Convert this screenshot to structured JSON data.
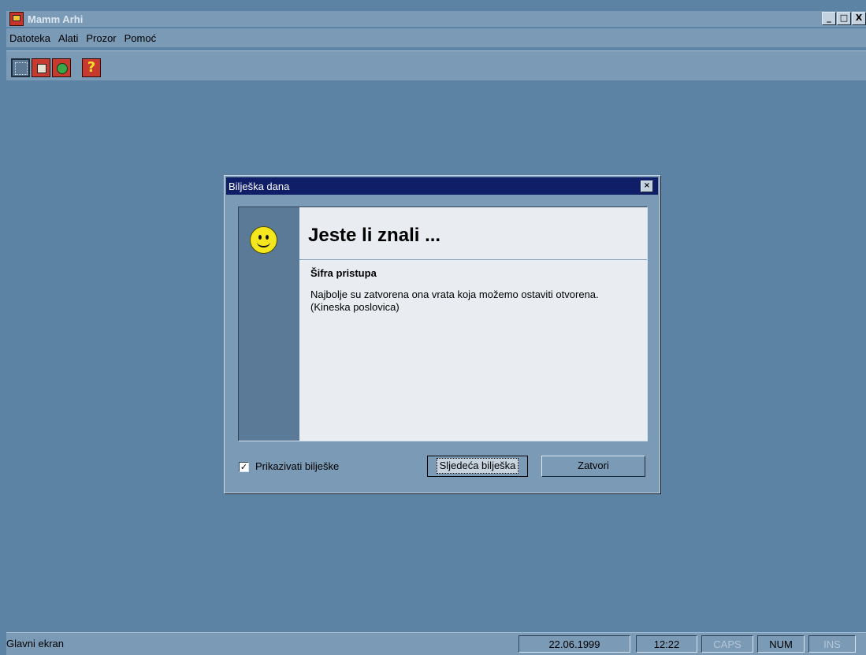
{
  "app": {
    "title": "Mamm Arhi",
    "icon": "app-icon",
    "window_controls": {
      "minimize": "_",
      "maximize": "□",
      "close": "X"
    }
  },
  "menu": {
    "items": [
      {
        "label": "Datoteka",
        "access_key": "D"
      },
      {
        "label": "Alati",
        "access_key": "A"
      },
      {
        "label": "Prozor",
        "access_key": "z"
      },
      {
        "label": "Pomoć",
        "access_key": "P"
      }
    ]
  },
  "toolbar": {
    "buttons": [
      {
        "icon": "select-frame-icon",
        "pressed": true
      },
      {
        "icon": "document-icon"
      },
      {
        "icon": "globe-icon"
      },
      {
        "icon": "help-icon",
        "glyph": "?"
      }
    ]
  },
  "dialog": {
    "title": "Bilješka dana",
    "close_glyph": "×",
    "heading": "Jeste li znali ...",
    "tip_title": "Šifra pristupa",
    "tip_text": "Najbolje su zatvorena ona vrata koja možemo ostaviti otvorena. (Kineska poslovica)",
    "icon": "smiley-icon",
    "show_checkbox": {
      "label": "Prikazivati bilješke",
      "checked": true,
      "mark": "✓"
    },
    "next_button": "Sljedeća bilješka",
    "close_button": "Zatvori"
  },
  "statusbar": {
    "message": "Glavni ekran",
    "date": "22.06.1999",
    "time": "12:22",
    "caps": "CAPS",
    "num": "NUM",
    "ins": "INS"
  },
  "colors": {
    "desktop": "#5c82a4",
    "chrome": "#7b9ab6",
    "dialog_title": "#0f1e66",
    "panel": "#e9edf1"
  }
}
